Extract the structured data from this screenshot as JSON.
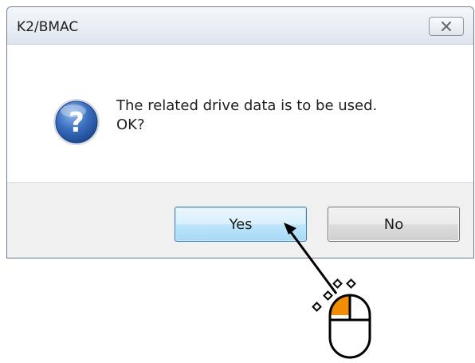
{
  "dialog": {
    "title": "K2/BMAC",
    "message_line1": "The related drive data is to be used.",
    "message_line2": "OK?",
    "icon": "question-icon",
    "close_icon": "close-icon"
  },
  "buttons": {
    "yes_label": "Yes",
    "no_label": "No"
  },
  "annotation": {
    "pointer_icon": "mouse-icon",
    "highlight_button": "left",
    "colors": {
      "mouse_highlight": "#f28c00",
      "arrow": "#000000"
    }
  },
  "colors": {
    "default_button_border": "#3c7fb1",
    "footer_background": "#f0f0f0",
    "icon_blue": "#2a5ca8"
  }
}
